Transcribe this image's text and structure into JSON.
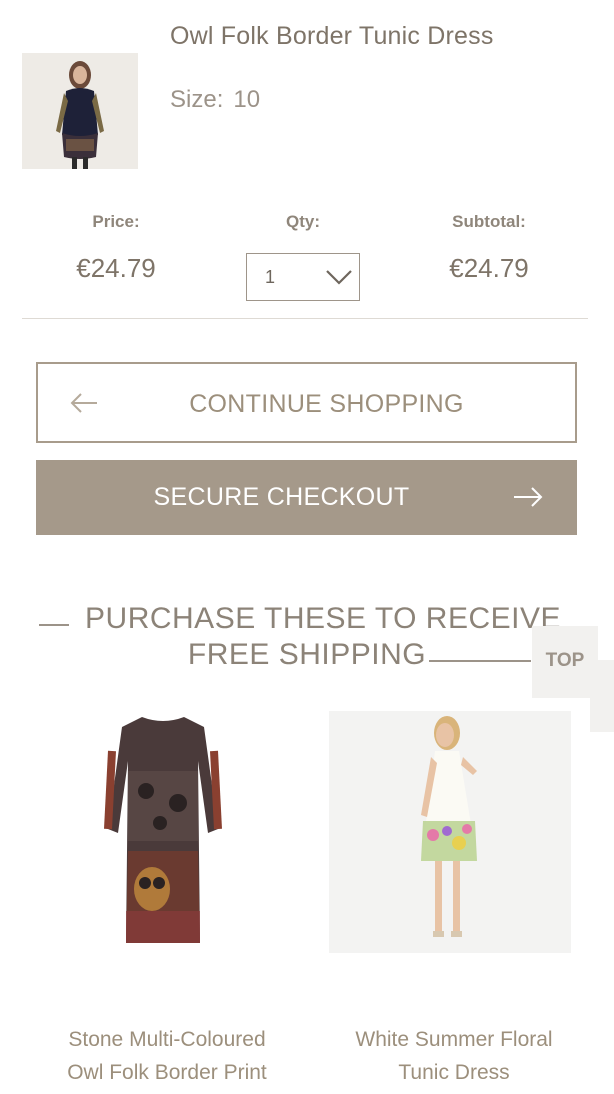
{
  "cart_item": {
    "name": "Owl Folk Border Tunic Dress",
    "size_label": "Size:",
    "size_value": "10",
    "price_label": "Price:",
    "price_value": "€24.79",
    "qty_label": "Qty:",
    "qty_value": "1",
    "subtotal_label": "Subtotal:",
    "subtotal_value": "€24.79"
  },
  "actions": {
    "continue_label": "CONTINUE SHOPPING",
    "checkout_label": "SECURE CHECKOUT"
  },
  "promo": {
    "line1": "PURCHASE THESE TO RECEIVE",
    "line2": "FREE SHIPPING"
  },
  "scroll_top_label": "TOP",
  "recommendations": [
    {
      "title_line1": "Stone Multi-Coloured",
      "title_line2": "Owl Folk Border Print"
    },
    {
      "title_line1": "White Summer Floral",
      "title_line2": "Tunic Dress"
    }
  ],
  "colors": {
    "accent": "#a5998a",
    "text": "#8a8073",
    "border": "#a89c8c"
  }
}
